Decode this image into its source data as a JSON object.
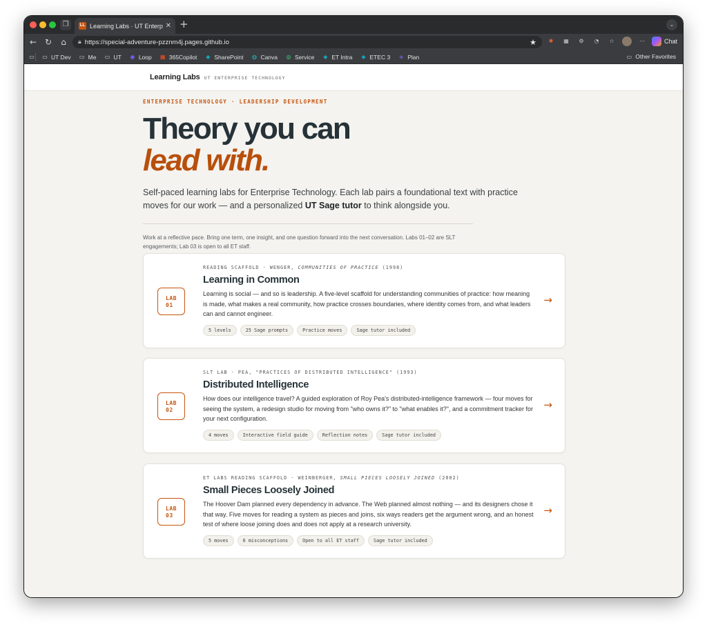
{
  "browser": {
    "tab_title": "Learning Labs · UT Enterprise Tech",
    "tab_favicon": "LL",
    "url": "https://special-adventure-pzznm4j.pages.github.io",
    "chat_label": "Chat",
    "bookmarks": [
      {
        "label": "UT Dev",
        "icon": "folder-icon"
      },
      {
        "label": "Me",
        "icon": "folder-icon"
      },
      {
        "label": "UT",
        "icon": "folder-icon"
      },
      {
        "label": "Loop",
        "icon": "loop-icon"
      },
      {
        "label": "365Copilot",
        "icon": "microsoft-icon"
      },
      {
        "label": "SharePoint",
        "icon": "sharepoint-icon"
      },
      {
        "label": "Canva",
        "icon": "canva-icon"
      },
      {
        "label": "Service",
        "icon": "service-icon"
      },
      {
        "label": "ET Intra",
        "icon": "sharepoint-icon"
      },
      {
        "label": "ETEC 3",
        "icon": "sharepoint-icon"
      },
      {
        "label": "Plan",
        "icon": "planner-icon"
      }
    ],
    "other_favorites": "Other Favorites"
  },
  "site": {
    "logo": "Learning Labs",
    "subtitle": "UT ENTERPRISE TECHNOLOGY"
  },
  "hero": {
    "eyebrow": "ENTERPRISE TECHNOLOGY · LEADERSHIP DEVELOPMENT",
    "headline_1": "Theory you can",
    "headline_2": "lead with.",
    "lede_pre": "Self-paced learning labs for Enterprise Technology. Each lab pairs a foundational text with practice moves for our work — and a personalized ",
    "lede_bold": "UT Sage tutor",
    "lede_post": " to think alongside you.",
    "note": "Work at a reflective pace. Bring one term, one insight, and one question forward into the next conversation. Labs 01–02 are SLT engagements; Lab 03 is open to all ET staff."
  },
  "labs": [
    {
      "badge_top": "LAB",
      "badge_num": "01",
      "meta_pre": "READING SCAFFOLD · WENGER, ",
      "meta_italic": "COMMUNITIES OF PRACTICE",
      "meta_post": " (1998)",
      "title": "Learning in Common",
      "desc": "Learning is social — and so is leadership. A five-level scaffold for understanding communities of practice: how meaning is made, what makes a real community, how practice crosses boundaries, where identity comes from, and what leaders can and cannot engineer.",
      "tags": [
        "5 levels",
        "25 Sage prompts",
        "Practice moves",
        "Sage tutor included"
      ],
      "arrow": "→"
    },
    {
      "badge_top": "LAB",
      "badge_num": "02",
      "meta_pre": "SLT LAB · PEA, \"PRACTICES OF DISTRIBUTED INTELLIGENCE\" (1993)",
      "meta_italic": "",
      "meta_post": "",
      "title": "Distributed Intelligence",
      "desc": "How does our intelligence travel? A guided exploration of Roy Pea's distributed-intelligence framework — four moves for seeing the system, a redesign studio for moving from \"who owns it?\" to \"what enables it?\", and a commitment tracker for your next configuration.",
      "tags": [
        "4 moves",
        "Interactive field guide",
        "Reflection notes",
        "Sage tutor included"
      ],
      "arrow": "→"
    },
    {
      "badge_top": "LAB",
      "badge_num": "03",
      "meta_pre": "ET LABS READING SCAFFOLD · WEINBERGER, ",
      "meta_italic": "SMALL PIECES LOOSELY JOINED",
      "meta_post": " (2002)",
      "title": "Small Pieces Loosely Joined",
      "desc": "The Hoover Dam planned every dependency in advance. The Web planned almost nothing — and its designers chose it that way. Five moves for reading a system as pieces and joins, six ways readers get the argument wrong, and an honest test of where loose joining does and does not apply at a research university.",
      "tags": [
        "5 moves",
        "6 misconceptions",
        "Open to all ET staff",
        "Sage tutor included"
      ],
      "arrow": "→"
    }
  ]
}
